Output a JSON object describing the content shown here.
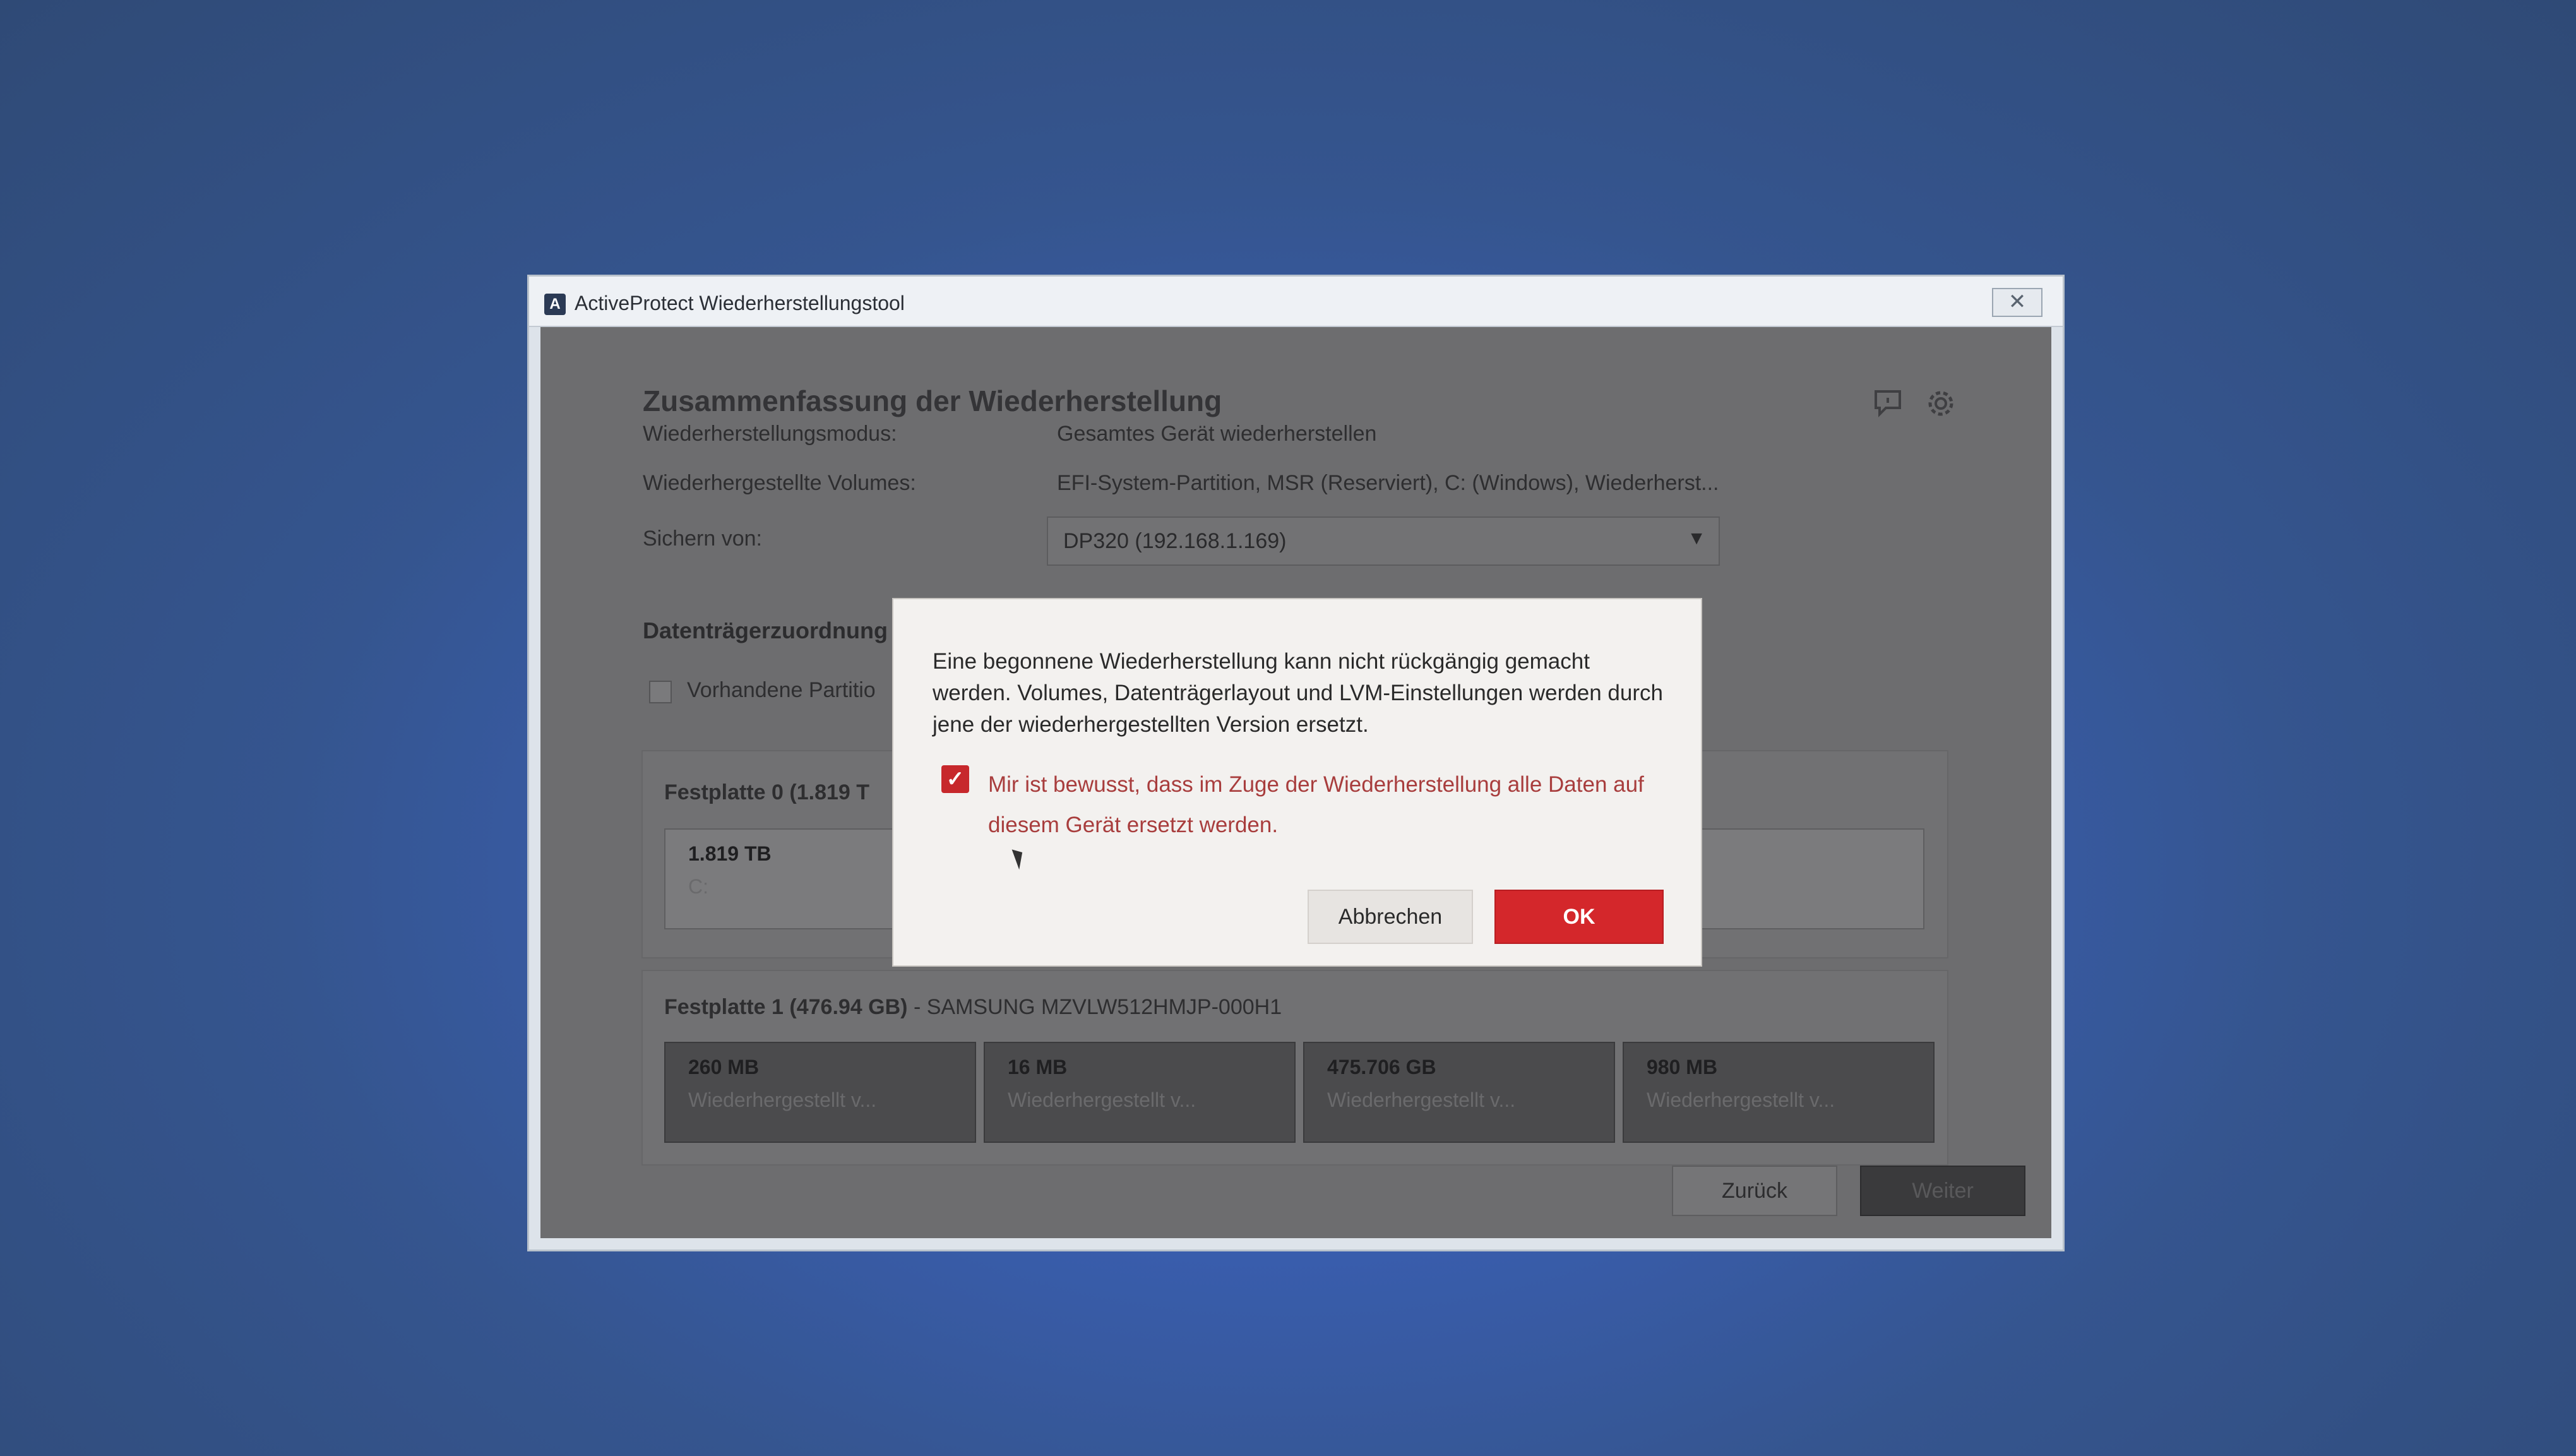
{
  "window": {
    "title": "ActiveProtect Wiederherstellungstool",
    "close_glyph": "✕"
  },
  "summary": {
    "page_title": "Zusammenfassung der Wiederherstellung",
    "rows": [
      {
        "label": "Wiederherstellungsmodus:",
        "value": "Gesamtes Gerät wiederherstellen"
      },
      {
        "label": "Wiederhergestellte Volumes:",
        "value": "EFI-System-Partition, MSR (Reserviert), C: (Windows), Wiederherst..."
      },
      {
        "label": "Sichern von:",
        "value": "DP320 (192.168.1.169)"
      }
    ],
    "icons": [
      "feedback-icon",
      "gear-icon"
    ]
  },
  "mapping": {
    "section_title": "Datenträgerzuordnung",
    "checkbox_label": "Vorhandene Partitio",
    "disk0": {
      "title": "Festplatte 0 (1.819 T",
      "partition": {
        "size": "1.819 TB",
        "sub": "C:"
      }
    },
    "disk1": {
      "title": "Festplatte 1 (476.94 GB)",
      "model": "- SAMSUNG MZVLW512HMJP-000H1",
      "partitions": [
        {
          "size": "260 MB",
          "sub": "Wiederhergestellt v..."
        },
        {
          "size": "16 MB",
          "sub": "Wiederhergestellt v..."
        },
        {
          "size": "475.706 GB",
          "sub": "Wiederhergestellt v..."
        },
        {
          "size": "980 MB",
          "sub": "Wiederhergestellt v..."
        }
      ]
    }
  },
  "footer": {
    "back_label": "Zurück",
    "next_label": "Weiter"
  },
  "dialog": {
    "message": "Eine begonnene Wiederherstellung kann nicht rückgängig gemacht werden. Volumes, Datenträgerlayout und LVM-Einstellungen werden durch jene der wiederhergestellten Version ersetzt.",
    "checkbox_label": "Mir ist bewusst, dass im Zuge der Wiederherstellung alle Daten auf diesem Gerät ersetzt werden.",
    "checkbox_checked": true,
    "cancel_label": "Abbrechen",
    "ok_label": "OK",
    "accent_color": "#d4272b"
  }
}
